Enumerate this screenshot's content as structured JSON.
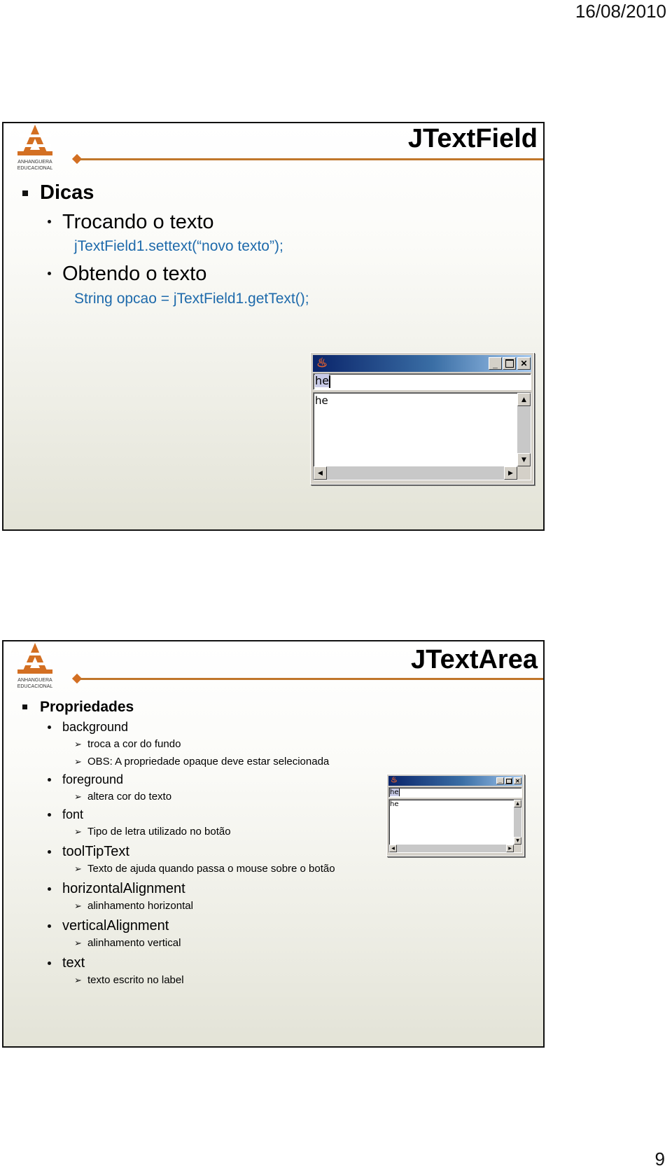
{
  "header": {
    "date": "16/08/2010"
  },
  "footer": {
    "page_number": "9"
  },
  "brand": {
    "logo_line1": "ANHANGUERA",
    "logo_line2": "EDUCACIONAL",
    "accent_color": "#d36f22",
    "line_color": "#c0762a",
    "code_color": "#1e6aab"
  },
  "slides": [
    {
      "title": "JTextField",
      "heading": "Dicas",
      "items": [
        {
          "label": "Trocando o texto",
          "code": "jTextField1.settext(“novo texto”);"
        },
        {
          "label": "Obtendo o texto",
          "code": "String opcao = jTextField1.getText();"
        }
      ],
      "window": {
        "icon": "java-icon",
        "buttons": [
          "minimize",
          "maximize",
          "close"
        ],
        "text_field_value": "he",
        "text_area_value": "he"
      }
    },
    {
      "title": "JTextArea",
      "heading": "Propriedades",
      "properties": [
        {
          "name": "background",
          "notes": [
            "troca a cor do fundo",
            "OBS: A propriedade opaque deve estar selecionada"
          ]
        },
        {
          "name": "foreground",
          "notes": [
            "altera cor do texto"
          ]
        },
        {
          "name": "font",
          "notes": [
            "Tipo de letra utilizado no botão"
          ]
        },
        {
          "name": "toolTipText",
          "notes": [
            "Texto de ajuda quando passa o mouse sobre o botão"
          ]
        },
        {
          "name": "horizontalAlignment",
          "notes": [
            "alinhamento horizontal"
          ]
        },
        {
          "name": "verticalAlignment",
          "notes": [
            "alinhamento vertical"
          ]
        },
        {
          "name": "text",
          "notes": [
            "texto escrito no label"
          ]
        }
      ],
      "window": {
        "icon": "java-icon",
        "buttons": [
          "minimize",
          "maximize",
          "close"
        ],
        "text_field_value": "he",
        "text_area_value": "he"
      }
    }
  ],
  "glyphs": {
    "arrow": "➢",
    "up": "▲",
    "down": "▼",
    "left": "◀",
    "right": "▶",
    "close": "✕",
    "java": "♨"
  }
}
